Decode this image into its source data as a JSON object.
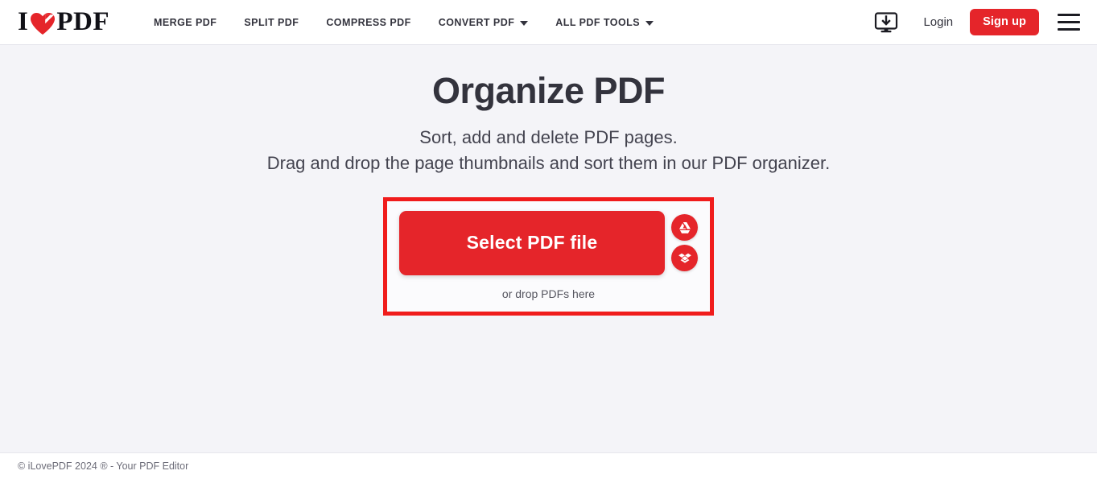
{
  "header": {
    "logo": {
      "left": "I",
      "right": "PDF",
      "icon": "heart-icon"
    },
    "nav": [
      {
        "label": "MERGE PDF",
        "has_caret": false
      },
      {
        "label": "SPLIT PDF",
        "has_caret": false
      },
      {
        "label": "COMPRESS PDF",
        "has_caret": false
      },
      {
        "label": "CONVERT PDF",
        "has_caret": true
      },
      {
        "label": "ALL PDF TOOLS",
        "has_caret": true
      }
    ],
    "desktop_icon": "desktop-download-icon",
    "login_label": "Login",
    "signup_label": "Sign up",
    "menu_icon": "hamburger-menu-icon"
  },
  "main": {
    "title": "Organize PDF",
    "subtitle_line1": "Sort, add and delete PDF pages.",
    "subtitle_line2": "Drag and drop the page thumbnails and sort them in our PDF organizer.",
    "select_button_label": "Select PDF file",
    "drop_hint": "or drop PDFs here",
    "cloud_buttons": [
      {
        "name": "google-drive-icon",
        "label": "Google Drive"
      },
      {
        "name": "dropbox-icon",
        "label": "Dropbox"
      }
    ]
  },
  "footer": {
    "text": "© iLovePDF 2024 ® - Your PDF Editor"
  },
  "colors": {
    "brand_red": "#e5252a",
    "annotation_red": "#f01c1c",
    "page_bg": "#f4f4f8",
    "text_dark": "#33333d"
  }
}
